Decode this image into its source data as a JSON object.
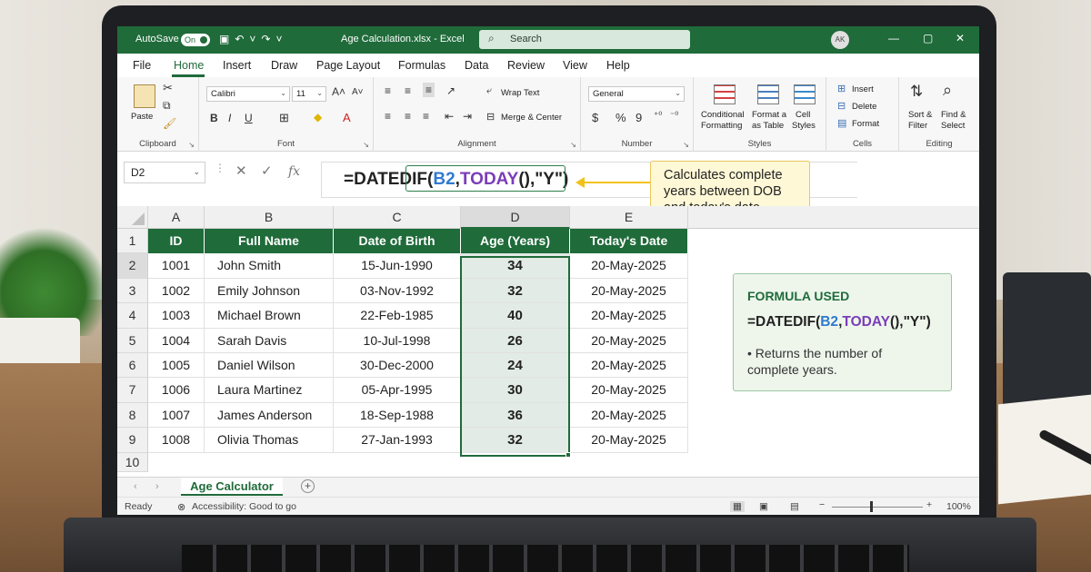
{
  "titlebar": {
    "autosave_label": "AutoSave",
    "autosave_state": "On",
    "file_title": "Age Calculation.xlsx - Excel",
    "search_placeholder": "Search",
    "user_initials": "AK"
  },
  "menu": [
    "File",
    "Home",
    "Insert",
    "Draw",
    "Page Layout",
    "Formulas",
    "Data",
    "Review",
    "View",
    "Help"
  ],
  "ribbon": {
    "clipboard": {
      "paste": "Paste",
      "label": "Clipboard"
    },
    "font": {
      "name": "Calibri",
      "size": "11",
      "label": "Font"
    },
    "alignment": {
      "wrap": "Wrap Text",
      "merge": "Merge & Center",
      "label": "Alignment"
    },
    "number": {
      "format": "General",
      "label": "Number"
    },
    "styles": {
      "conditional_1": "Conditional",
      "conditional_2": "Formatting",
      "format_table_1": "Format a",
      "format_table_2": "as Table",
      "cell_styles_1": "Cell",
      "cell_styles_2": "Styles",
      "label": "Styles"
    },
    "cells": {
      "insert": "Insert",
      "delete": "Delete",
      "format": "Format",
      "label": "Cells"
    },
    "editing": {
      "sort_1": "Sort &",
      "sort_2": "Filter",
      "find_1": "Find &",
      "find_2": "Select",
      "label": "Editing"
    }
  },
  "formula_bar": {
    "name_box": "D2",
    "formula_prefix": "=DATEDIF(",
    "formula_ref": "B2",
    "formula_sep": ",",
    "formula_fn": "TODAY",
    "formula_suffix": "(),\"Y\")",
    "callout": "Calculates complete years between DOB and today's date"
  },
  "sheet": {
    "columns": [
      "A",
      "B",
      "C",
      "D",
      "E"
    ],
    "row_numbers": [
      "1",
      "2",
      "3",
      "4",
      "5",
      "6",
      "7",
      "8",
      "9",
      "10"
    ],
    "headers": [
      "ID",
      "Full Name",
      "Date of Birth",
      "Age (Years)",
      "Today's Date"
    ],
    "rows": [
      {
        "id": "1001",
        "name": "John Smith",
        "dob": "15-Jun-1990",
        "age": "34",
        "today": "20-May-2025"
      },
      {
        "id": "1002",
        "name": "Emily Johnson",
        "dob": "03-Nov-1992",
        "age": "32",
        "today": "20-May-2025"
      },
      {
        "id": "1003",
        "name": "Michael Brown",
        "dob": "22-Feb-1985",
        "age": "40",
        "today": "20-May-2025"
      },
      {
        "id": "1004",
        "name": "Sarah Davis",
        "dob": "10-Jul-1998",
        "age": "26",
        "today": "20-May-2025"
      },
      {
        "id": "1005",
        "name": "Daniel Wilson",
        "dob": "30-Dec-2000",
        "age": "24",
        "today": "20-May-2025"
      },
      {
        "id": "1006",
        "name": "Laura Martinez",
        "dob": "05-Apr-1995",
        "age": "30",
        "today": "20-May-2025"
      },
      {
        "id": "1007",
        "name": "James Anderson",
        "dob": "18-Sep-1988",
        "age": "36",
        "today": "20-May-2025"
      },
      {
        "id": "1008",
        "name": "Olivia Thomas",
        "dob": "27-Jan-1993",
        "age": "32",
        "today": "20-May-2025"
      }
    ]
  },
  "infobox": {
    "heading": "FORMULA USED",
    "formula_prefix": "=DATEDIF(",
    "formula_ref": "B2",
    "formula_sep": ",",
    "formula_fn": "TODAY",
    "formula_suffix": "(),\"Y\")",
    "bullet": "• Returns the number of complete years."
  },
  "tabs": {
    "active": "Age Calculator"
  },
  "status": {
    "ready": "Ready",
    "accessibility": "Accessibility: Good to go",
    "zoom": "100%"
  },
  "colors": {
    "brand": "#1f6b3a",
    "ref": "#2f7ad0",
    "fn": "#7a3db8",
    "callout_bg": "#fff8d6"
  }
}
